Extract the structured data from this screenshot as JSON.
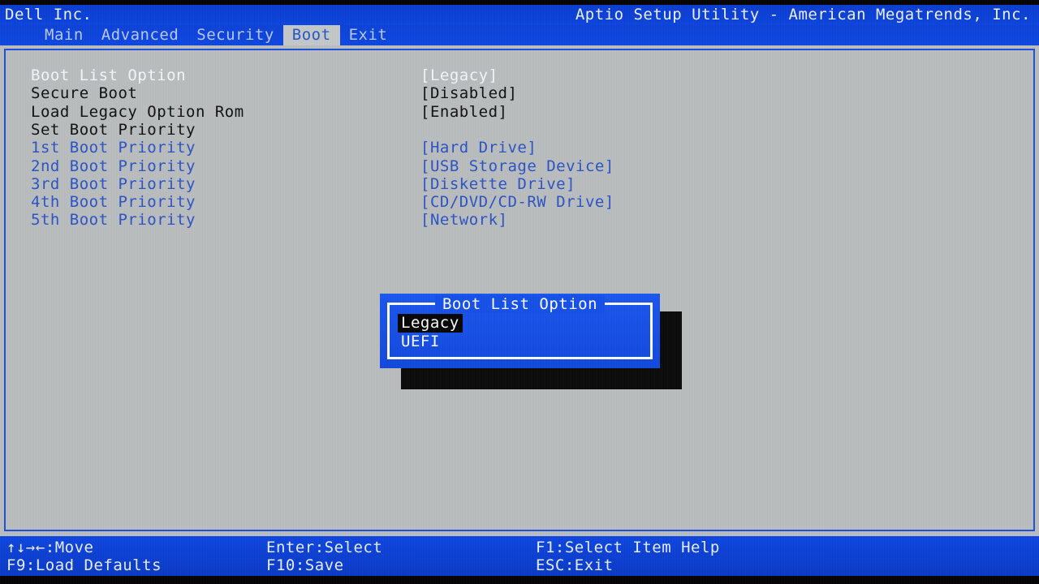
{
  "header": {
    "vendor": "Dell Inc.",
    "product": "Aptio Setup Utility - American Megatrends, Inc."
  },
  "tabs": [
    {
      "label": "Main",
      "active": false
    },
    {
      "label": "Advanced",
      "active": false
    },
    {
      "label": "Security",
      "active": false
    },
    {
      "label": "Boot",
      "active": true
    },
    {
      "label": "Exit",
      "active": false
    }
  ],
  "settings": [
    {
      "label": "Boot List Option",
      "value": "[Legacy]",
      "state": "selected"
    },
    {
      "label": "Secure Boot",
      "value": "[Disabled]",
      "state": "normal"
    },
    {
      "label": "Load Legacy Option Rom",
      "value": "[Enabled]",
      "state": "normal"
    },
    {
      "label": "Set Boot Priority",
      "value": "",
      "state": "normal"
    },
    {
      "label": "1st Boot Priority",
      "value": "[Hard Drive]",
      "state": "link"
    },
    {
      "label": "2nd Boot Priority",
      "value": "[USB Storage Device]",
      "state": "link"
    },
    {
      "label": "3rd Boot Priority",
      "value": "[Diskette Drive]",
      "state": "link"
    },
    {
      "label": "4th Boot Priority",
      "value": "[CD/DVD/CD-RW Drive]",
      "state": "link"
    },
    {
      "label": "5th Boot Priority",
      "value": "[Network]",
      "state": "link"
    }
  ],
  "dialog": {
    "title": "Boot List Option",
    "options": [
      {
        "label": "Legacy",
        "selected": true
      },
      {
        "label": "UEFI",
        "selected": false
      }
    ]
  },
  "footer": {
    "move": "↑↓→←:Move",
    "enter_select": "Enter:Select",
    "select_item_help": "F1:Select Item Help",
    "load_defaults": "F9:Load Defaults",
    "save": "F10:Save",
    "exit": "ESC:Exit"
  },
  "colors": {
    "blue_chrome": "#0b3fd4",
    "panel_bg": "#b9bdbe",
    "link_blue": "#2b53c4",
    "dialog_blue": "#1550e8",
    "selected_text": "#f4f6fa"
  }
}
